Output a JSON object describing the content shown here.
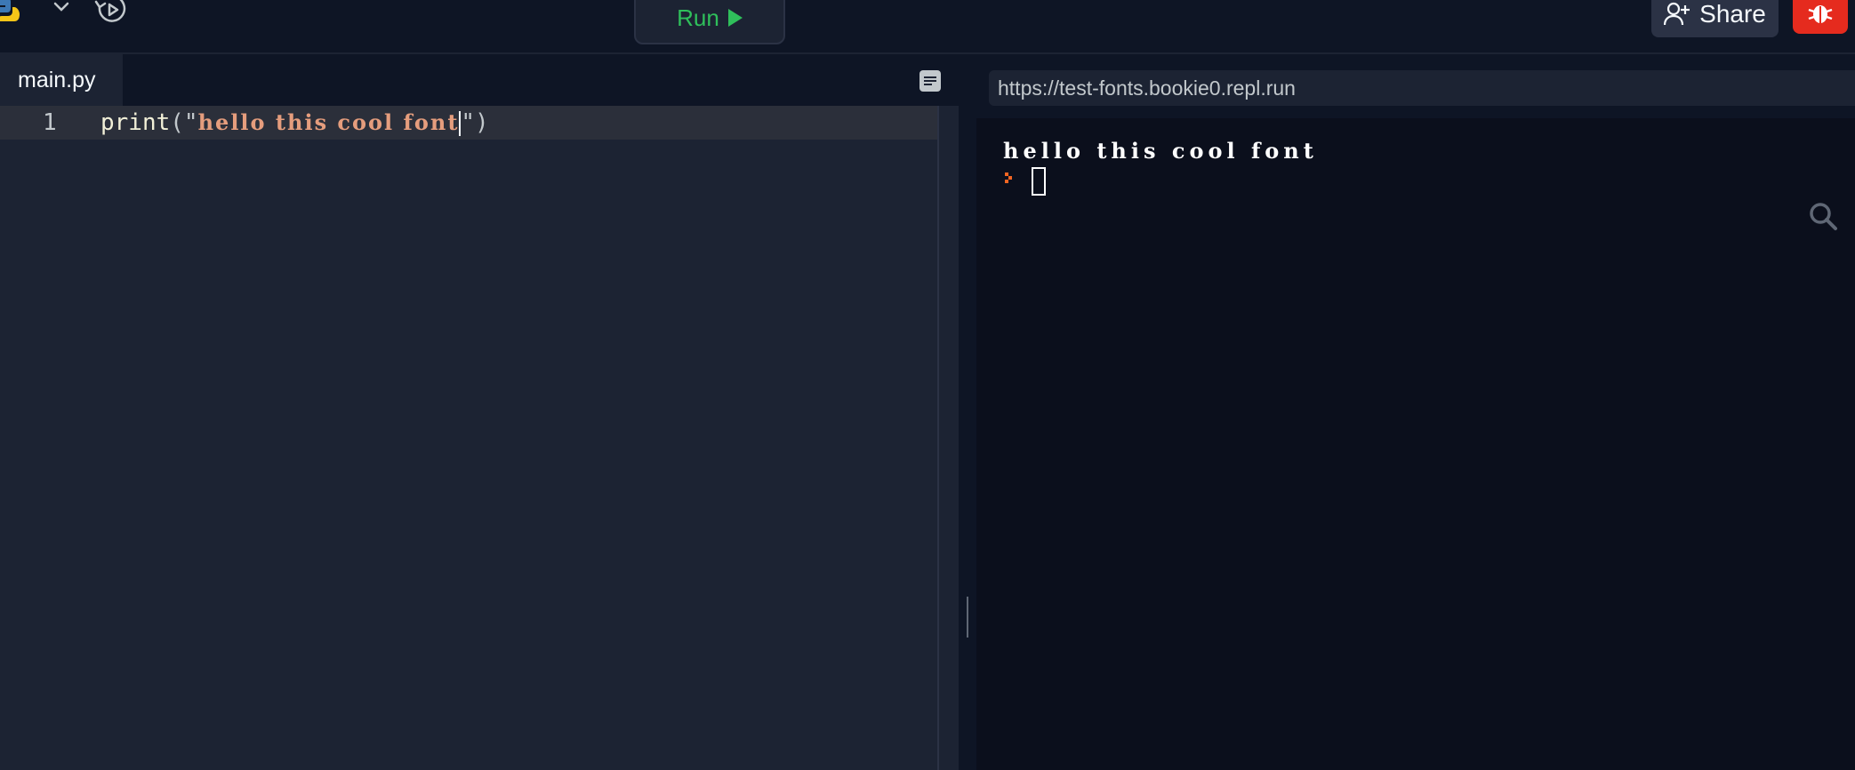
{
  "toolbar": {
    "run_label": "Run",
    "share_label": "Share"
  },
  "editor": {
    "tab_label": "main.py",
    "lines": [
      {
        "number": "1",
        "fn": "print",
        "open": "(\"",
        "string": "hello this cool font",
        "close": "\")"
      }
    ]
  },
  "webview": {
    "url": "https://test-fonts.bookie0.repl.run"
  },
  "console": {
    "output": "hello this cool font"
  },
  "colors": {
    "run_green": "#2fbf5b",
    "debug_red": "#e52b1e",
    "prompt_orange": "#f26522",
    "string_color": "#e59d7d"
  },
  "icons": [
    "python-icon",
    "chevron-down-icon",
    "history-icon",
    "play-icon",
    "add-user-icon",
    "bug-icon",
    "menu-icon",
    "search-icon",
    "prompt-icon"
  ]
}
